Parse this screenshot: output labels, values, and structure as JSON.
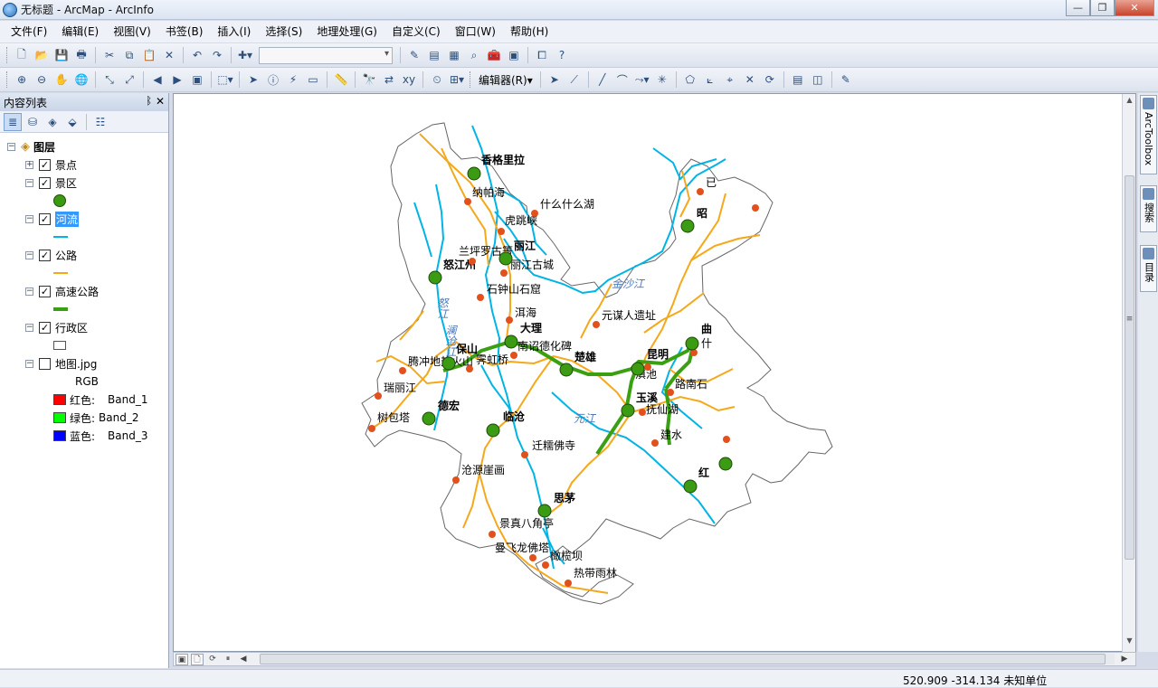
{
  "window": {
    "title": "无标题 - ArcMap - ArcInfo",
    "controls": [
      "0",
      "1",
      "r"
    ]
  },
  "menu": [
    "文件(F)",
    "编辑(E)",
    "视图(V)",
    "书签(B)",
    "插入(I)",
    "选择(S)",
    "地理处理(G)",
    "自定义(C)",
    "窗口(W)",
    "帮助(H)"
  ],
  "toolbar2": {
    "editor_label": "编辑器(R)▾"
  },
  "toc": {
    "title": "内容列表",
    "pin": "ᛔ",
    "close": "✕",
    "layers_root": "图层",
    "layers": [
      {
        "name": "景点",
        "expanded": false,
        "checked": true
      },
      {
        "name": "景区",
        "expanded": true,
        "checked": true,
        "symbol": "green-dot"
      },
      {
        "name": "河流",
        "expanded": true,
        "checked": true,
        "symbol": "blue-line",
        "selected": true
      },
      {
        "name": "公路",
        "expanded": true,
        "checked": true,
        "symbol": "orange-line"
      },
      {
        "name": "高速公路",
        "expanded": true,
        "checked": true,
        "symbol": "green-line"
      },
      {
        "name": "行政区",
        "expanded": true,
        "checked": true,
        "symbol": "polygon"
      },
      {
        "name": "地图.jpg",
        "expanded": true,
        "checked": false
      }
    ],
    "raster": {
      "rgb": "RGB",
      "bands": [
        {
          "label": "红色:",
          "band": "Band_1",
          "color": "#ff0000"
        },
        {
          "label": "绿色:",
          "band": "Band_2",
          "color": "#00ff00"
        },
        {
          "label": "蓝色:",
          "band": "Band_3",
          "color": "#0000ff"
        }
      ]
    }
  },
  "map": {
    "colors": {
      "river": "#00b4e6",
      "road": "#f5a81a",
      "highway": "#3aa012",
      "spot": "#e2501b",
      "city": "#3b9c14",
      "boundary": "#666666"
    },
    "cities": [
      "香格里拉",
      "丽江",
      "怒江州",
      "大理",
      "保山",
      "楚雄",
      "昆明",
      "曲",
      "昭",
      "玉溪",
      "德宏",
      "临沧",
      "红",
      "思茅"
    ],
    "spots": [
      "纳帕海",
      "什么什么湖",
      "虎跳峡",
      "兰坪罗古箐",
      "丽江古城",
      "石钟山石窟",
      "洱海",
      "元谋人遗址",
      "南诏德化碑",
      "腾冲地热火山",
      "霁虹桥",
      "瑞丽江",
      "树包塔",
      "滇池",
      "路南石",
      "抚仙湖",
      "建水",
      "迁糯佛寺",
      "沧源崖画",
      "景真八角亭",
      "曼飞龙佛塔",
      "橄榄坝",
      "热带雨林",
      "什",
      "已"
    ],
    "rivers": [
      "金沙江",
      "怒江",
      "澜沧江",
      "元江"
    ]
  },
  "rdock": {
    "tabs": [
      "ArcToolbox",
      "搜索",
      "目录"
    ]
  },
  "status": {
    "coords": "520.909  -314.134 未知单位"
  }
}
